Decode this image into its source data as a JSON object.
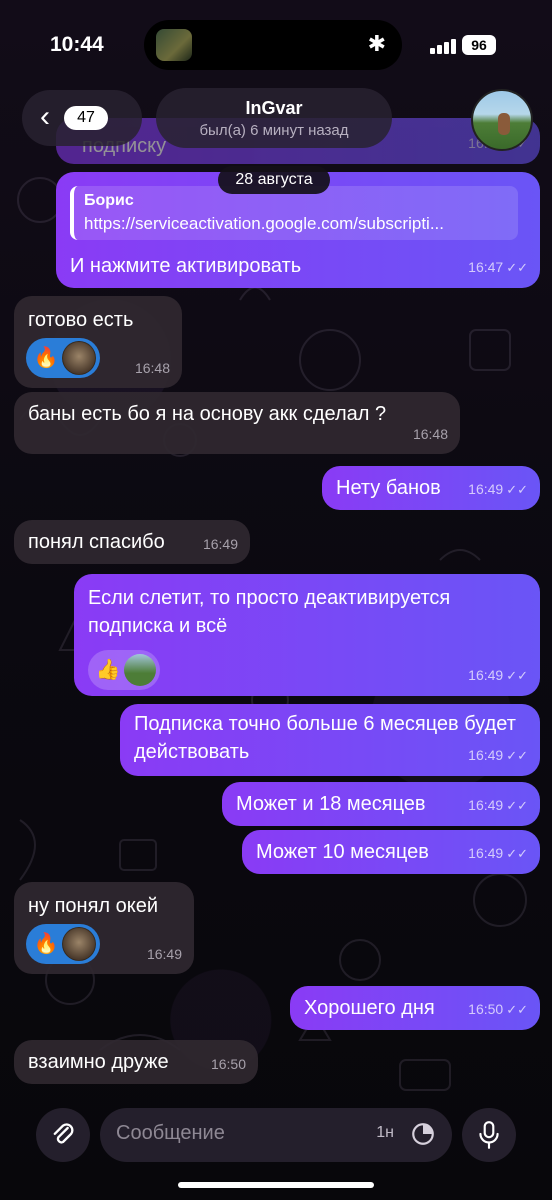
{
  "status_bar": {
    "time": "10:44",
    "battery": "96",
    "bluetooth_icon": "bluetooth-icon",
    "signal_icon": "cellular-signal-icon"
  },
  "header": {
    "back_badge": "47",
    "title": "InGvar",
    "subtitle": "был(а) 6 минут назад"
  },
  "date_chip": "28 августа",
  "messages": [
    {
      "dir": "out",
      "quote_author": "Борис",
      "quote_link": "https://serviceactivation.google.com/subscripti...",
      "text": "И нажмите активировать",
      "time": "16:47",
      "read": true
    },
    {
      "dir": "in",
      "text": "готово есть",
      "time": "16:48",
      "reactions": [
        "🔥",
        "avatar"
      ]
    },
    {
      "dir": "in",
      "text": "баны есть бо я на основу акк сделал ?",
      "time": "16:48"
    },
    {
      "dir": "out",
      "text": "Нету банов",
      "time": "16:49",
      "read": true
    },
    {
      "dir": "in",
      "text": "понял спасибо",
      "time": "16:49"
    },
    {
      "dir": "out",
      "text": "Если слетит, то просто деактивируется подписка и всё",
      "time": "16:49",
      "read": true,
      "reactions": [
        "👍",
        "avatar"
      ]
    },
    {
      "dir": "out",
      "text": "Подписка точно больше 6 месяцев будет действовать",
      "time": "16:49",
      "read": true
    },
    {
      "dir": "out",
      "text": "Может и 18 месяцев",
      "time": "16:49",
      "read": true
    },
    {
      "dir": "out",
      "text": "Может 10 месяцев",
      "time": "16:49",
      "read": true
    },
    {
      "dir": "in",
      "text": "ну понял окей",
      "time": "16:49",
      "reactions": [
        "🔥",
        "avatar"
      ]
    },
    {
      "dir": "out",
      "text": "Хорошего дня",
      "time": "16:50",
      "read": true
    },
    {
      "dir": "in",
      "text": "взаимно друже",
      "time": "16:50"
    }
  ],
  "partial_top": {
    "text": "подписку",
    "time": "16:47"
  },
  "composer": {
    "placeholder": "Сообщение",
    "timer_label": "1н"
  },
  "colors": {
    "outgoing_start": "#8a3bf5",
    "outgoing_end": "#6a55f6",
    "incoming": "#302830",
    "reaction_blue": "#2a7dd8"
  }
}
